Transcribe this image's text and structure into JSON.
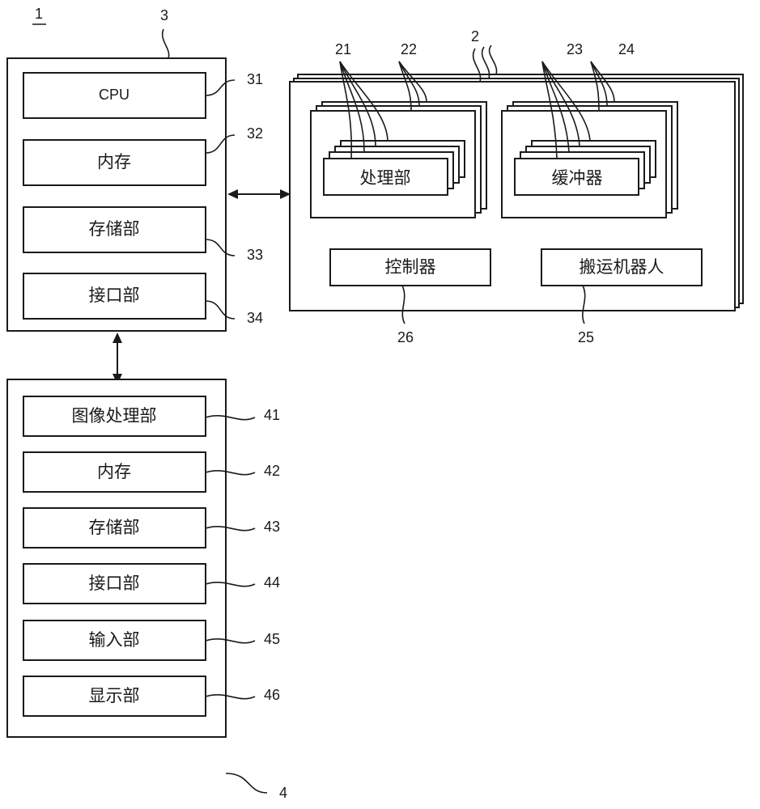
{
  "figure_ref": "1",
  "controller_unit": {
    "ref": "3",
    "items": [
      {
        "label": "CPU",
        "ref": "31"
      },
      {
        "label": "内存",
        "ref": "32"
      },
      {
        "label": "存储部",
        "ref": "33"
      },
      {
        "label": "接口部",
        "ref": "34"
      }
    ]
  },
  "substrate_processing_apparatus": {
    "ref": "2",
    "processing_module": {
      "ref": "22",
      "inner_label": "处理部",
      "inner_ref": "21"
    },
    "buffer_module": {
      "ref": "24",
      "inner_label": "缓冲器",
      "inner_ref": "23"
    },
    "controller": {
      "label": "控制器",
      "ref": "26"
    },
    "transfer_robot": {
      "label": "搬运机器人",
      "ref": "25"
    }
  },
  "image_processing_unit": {
    "ref": "4",
    "items": [
      {
        "label": "图像处理部",
        "ref": "41"
      },
      {
        "label": "内存",
        "ref": "42"
      },
      {
        "label": "存储部",
        "ref": "43"
      },
      {
        "label": "接口部",
        "ref": "44"
      },
      {
        "label": "输入部",
        "ref": "45"
      },
      {
        "label": "显示部",
        "ref": "46"
      }
    ]
  }
}
